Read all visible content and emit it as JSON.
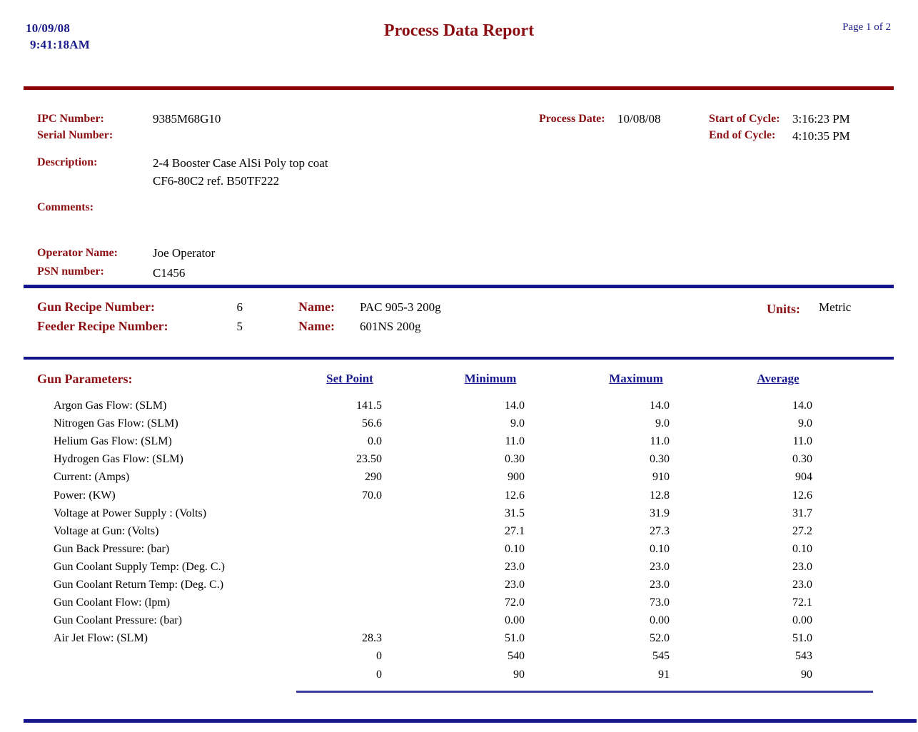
{
  "header": {
    "date": "10/09/08",
    "time": "9:41:18AM",
    "title": "Process Data Report",
    "page_label": "Page 1 of 2"
  },
  "identification": {
    "ipc_number_label": "IPC Number:",
    "ipc_number_value": "9385M68G10",
    "serial_number_label": "Serial Number:",
    "serial_number_value": "",
    "description_label": "Description:",
    "description_line1": "2-4 Booster Case AlSi Poly top coat",
    "description_line2": "CF6-80C2  ref.  B50TF222",
    "comments_label": "Comments:",
    "comments_value": "",
    "operator_name_label": "Operator Name:",
    "operator_name_value": "Joe Operator",
    "psn_number_label": "PSN number:",
    "psn_number_value": "C1456",
    "process_date_label": "Process Date:",
    "process_date_value": "10/08/08",
    "start_of_cycle_label": "Start of Cycle:",
    "start_of_cycle_value": "3:16:23 PM",
    "end_of_cycle_label": "End of Cycle:",
    "end_of_cycle_value": "4:10:35 PM"
  },
  "recipe": {
    "gun_recipe_label": "Gun Recipe Number:",
    "gun_recipe_number": "6",
    "gun_name_label": "Name:",
    "gun_recipe_name": "PAC 905-3 200g",
    "feeder_recipe_label": "Feeder Recipe Number:",
    "feeder_recipe_number": "5",
    "feeder_name_label": "Name:",
    "feeder_recipe_name": "601NS 200g",
    "units_label": "Units:",
    "units_value": "Metric"
  },
  "gun_parameters": {
    "section_title": "Gun Parameters:",
    "columns": {
      "set_point": "Set Point",
      "minimum": "Minimum",
      "maximum": "Maximum",
      "average": "Average"
    },
    "rows": [
      {
        "name": "Argon Gas Flow:     (SLM)",
        "set_point": "141.5",
        "minimum": "14.0",
        "maximum": "14.0",
        "average": "14.0"
      },
      {
        "name": "Nitrogen  Gas Flow:      (SLM)",
        "set_point": "56.6",
        "minimum": "9.0",
        "maximum": "9.0",
        "average": "9.0"
      },
      {
        "name": "Helium  Gas Flow:     (SLM)",
        "set_point": "0.0",
        "minimum": "11.0",
        "maximum": "11.0",
        "average": "11.0"
      },
      {
        "name": " Hydrogen Gas Flow:      (SLM)",
        "set_point": "23.50",
        "minimum": "0.30",
        "maximum": "0.30",
        "average": "0.30"
      },
      {
        "name": "Current:  (Amps)",
        "set_point": "290",
        "minimum": "900",
        "maximum": "910",
        "average": "904"
      },
      {
        "name": "Power:  (KW)",
        "set_point": "70.0",
        "minimum": "12.6",
        "maximum": "12.8",
        "average": "12.6"
      },
      {
        "name": "Voltage at Power Supply :  (Volts)",
        "set_point": "",
        "minimum": "31.5",
        "maximum": "31.9",
        "average": "31.7"
      },
      {
        "name": "Voltage at Gun:  (Volts)",
        "set_point": "",
        "minimum": "27.1",
        "maximum": "27.3",
        "average": "27.2"
      },
      {
        "name": "Gun Back Pressure:            (bar)",
        "set_point": "",
        "minimum": "0.10",
        "maximum": "0.10",
        "average": "0.10"
      },
      {
        "name": "Gun Coolant Supply Temp:         (Deg. C.)",
        "set_point": "",
        "minimum": "23.0",
        "maximum": "23.0",
        "average": "23.0"
      },
      {
        "name": "Gun Coolant Return Temp:         (Deg. C.)",
        "set_point": "",
        "minimum": "23.0",
        "maximum": "23.0",
        "average": "23.0"
      },
      {
        "name": "Gun Coolant Flow:     (lpm)",
        "set_point": "",
        "minimum": "72.0",
        "maximum": "73.0",
        "average": "72.1"
      },
      {
        "name": "Gun Coolant Pressure:          (bar)",
        "set_point": "",
        "minimum": "0.00",
        "maximum": "0.00",
        "average": "0.00"
      },
      {
        "name": "Air Jet Flow:        (SLM)",
        "set_point": "28.3",
        "minimum": "51.0",
        "maximum": "52.0",
        "average": "51.0"
      },
      {
        "name": "",
        "set_point": "0",
        "minimum": "540",
        "maximum": "545",
        "average": "543"
      },
      {
        "name": "",
        "set_point": "0",
        "minimum": "90",
        "maximum": "91",
        "average": "90"
      }
    ]
  },
  "colors": {
    "navy": "#1a1a8c",
    "dark_red": "#8b0f13",
    "rule_red": "#8b0000",
    "rule_navy": "#14148c"
  }
}
